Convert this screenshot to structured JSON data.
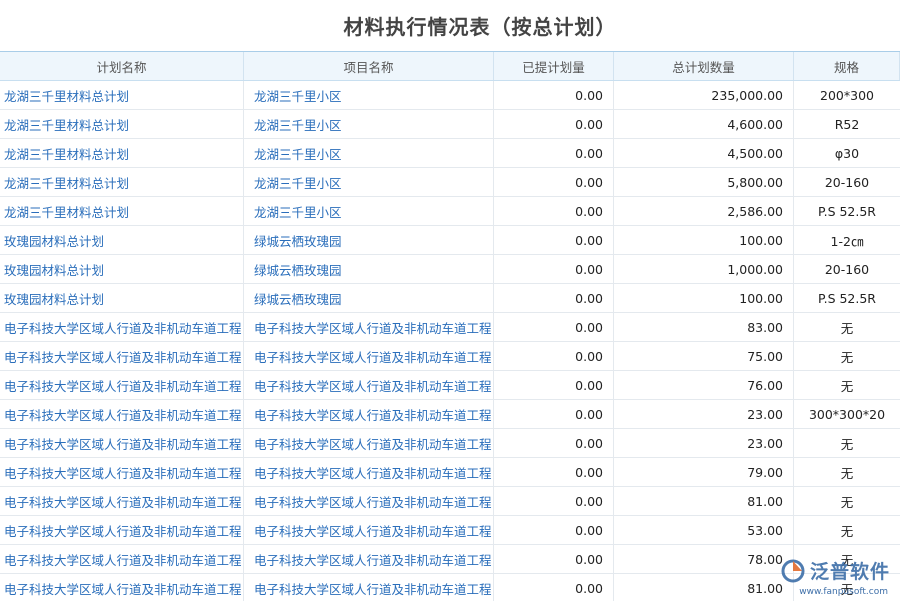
{
  "page": {
    "title": "材料执行情况表（按总计划）"
  },
  "table": {
    "columns": [
      "计划名称",
      "项目名称",
      "已提计划量",
      "总计划数量",
      "规格"
    ],
    "rows": [
      [
        "龙湖三千里材料总计划",
        "龙湖三千里小区",
        "0.00",
        "235,000.00",
        "200*300"
      ],
      [
        "龙湖三千里材料总计划",
        "龙湖三千里小区",
        "0.00",
        "4,600.00",
        "R52"
      ],
      [
        "龙湖三千里材料总计划",
        "龙湖三千里小区",
        "0.00",
        "4,500.00",
        "φ30"
      ],
      [
        "龙湖三千里材料总计划",
        "龙湖三千里小区",
        "0.00",
        "5,800.00",
        "20-160"
      ],
      [
        "龙湖三千里材料总计划",
        "龙湖三千里小区",
        "0.00",
        "2,586.00",
        "P.S 52.5R"
      ],
      [
        "玫瑰园材料总计划",
        "绿城云栖玫瑰园",
        "0.00",
        "100.00",
        "1-2㎝"
      ],
      [
        "玫瑰园材料总计划",
        "绿城云栖玫瑰园",
        "0.00",
        "1,000.00",
        "20-160"
      ],
      [
        "玫瑰园材料总计划",
        "绿城云栖玫瑰园",
        "0.00",
        "100.00",
        "P.S 52.5R"
      ],
      [
        "电子科技大学区域人行道及非机动车道工程",
        "电子科技大学区域人行道及非机动车道工程",
        "0.00",
        "83.00",
        "无"
      ],
      [
        "电子科技大学区域人行道及非机动车道工程",
        "电子科技大学区域人行道及非机动车道工程",
        "0.00",
        "75.00",
        "无"
      ],
      [
        "电子科技大学区域人行道及非机动车道工程",
        "电子科技大学区域人行道及非机动车道工程",
        "0.00",
        "76.00",
        "无"
      ],
      [
        "电子科技大学区域人行道及非机动车道工程",
        "电子科技大学区域人行道及非机动车道工程",
        "0.00",
        "23.00",
        "300*300*20"
      ],
      [
        "电子科技大学区域人行道及非机动车道工程",
        "电子科技大学区域人行道及非机动车道工程",
        "0.00",
        "23.00",
        "无"
      ],
      [
        "电子科技大学区域人行道及非机动车道工程",
        "电子科技大学区域人行道及非机动车道工程",
        "0.00",
        "79.00",
        "无"
      ],
      [
        "电子科技大学区域人行道及非机动车道工程",
        "电子科技大学区域人行道及非机动车道工程",
        "0.00",
        "81.00",
        "无"
      ],
      [
        "电子科技大学区域人行道及非机动车道工程",
        "电子科技大学区域人行道及非机动车道工程",
        "0.00",
        "53.00",
        "无"
      ],
      [
        "电子科技大学区域人行道及非机动车道工程",
        "电子科技大学区域人行道及非机动车道工程",
        "0.00",
        "78.00",
        "无"
      ],
      [
        "电子科技大学区域人行道及非机动车道工程",
        "电子科技大学区域人行道及非机动车道工程",
        "0.00",
        "81.00",
        "无"
      ]
    ]
  },
  "watermark": {
    "brand": "泛普软件",
    "url": "www.fanpusoft.com",
    "icon": "fanpu-logo-icon"
  },
  "colors": {
    "link": "#2a6ebb",
    "header_bg": "#eef6fc",
    "brand": "#3d6ea8"
  }
}
